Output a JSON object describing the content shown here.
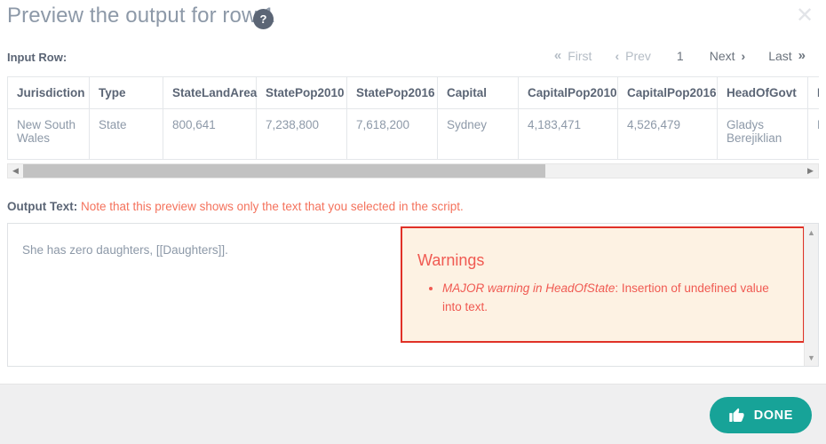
{
  "dialog": {
    "title": "Preview the output for row 1",
    "help_icon_label": "?",
    "close_icon_label": "✕"
  },
  "input_section": {
    "label": "Input Row:",
    "pager": {
      "first": {
        "label": "First",
        "icon": "«",
        "enabled": false
      },
      "prev": {
        "label": "Prev",
        "icon": "‹",
        "enabled": false
      },
      "current_page": "1",
      "next": {
        "label": "Next",
        "icon": "›",
        "enabled": true
      },
      "last": {
        "label": "Last",
        "icon": "»",
        "enabled": true
      }
    },
    "table": {
      "headers": [
        "Jurisdiction",
        "Type",
        "StateLandArea",
        "StatePop2010",
        "StatePop2016",
        "Capital",
        "CapitalPop2010",
        "CapitalPop2016",
        "HeadOfGovt",
        "Party"
      ],
      "rows": [
        [
          "New South Wales",
          "State",
          "800,641",
          "7,238,800",
          "7,618,200",
          "Sydney",
          "4,183,471",
          "4,526,479",
          "Gladys Berejiklian",
          "Liberal"
        ]
      ]
    },
    "hscroll": {
      "left_arrow": "◀",
      "right_arrow": "▶"
    }
  },
  "output_section": {
    "label_strong": "Output Text:",
    "label_note": "Note that this preview shows only the text that you selected in the script.",
    "output_text": "She has zero daughters, [[Daughters]].",
    "warnings": {
      "title": "Warnings",
      "items": [
        {
          "emphasis": "MAJOR warning in HeadOfState",
          "rest": ": Insertion of undefined value into text."
        }
      ],
      "border_color": "#e03127",
      "background_color": "#fdf2e3",
      "text_color": "#f05a52"
    },
    "vscroll": {
      "up_arrow": "▲",
      "down_arrow": "▼"
    }
  },
  "footer": {
    "done_label": "DONE",
    "done_icon": "thumbs-up-icon",
    "accent_color": "#17a398"
  }
}
